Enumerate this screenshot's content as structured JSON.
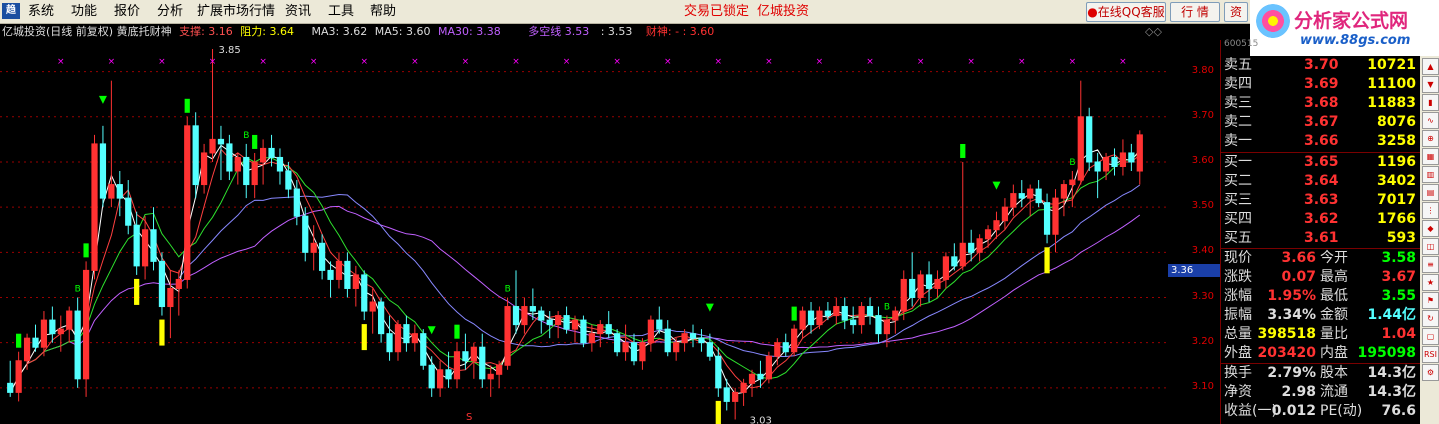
{
  "menubar": {
    "app_icon": "趋",
    "items": [
      "系统",
      "功能",
      "报价",
      "分析",
      "扩展市场行情",
      "资讯",
      "工具",
      "帮助"
    ],
    "status_locked": "交易已锁定",
    "status_brand": "亿城投资",
    "qq_button": "在线QQ客服",
    "quote_button": "行 情",
    "partial_button": "资"
  },
  "logo": {
    "text": "分析家公式网",
    "url": "www.88gs.com"
  },
  "legend": {
    "title": "亿城投资(日线 前复权) 黄底托财神",
    "support_label": "支撑:",
    "support_value": "3.16",
    "resistance_label": "阻力:",
    "resistance_value": "3.64",
    "ma3_label": "MA3:",
    "ma3_value": "3.62",
    "ma5_label": "MA5:",
    "ma5_value": "3.60",
    "ma30_label": "MA30:",
    "ma30_value": "3.38",
    "dk_label": "多空线",
    "dk_value": "3.53",
    "dk_value2": ": 3.53",
    "caishen_label": "财神:",
    "caishen_value": "- : 3.60",
    "partial_code": "600515"
  },
  "colors": {
    "up": "#ff3232",
    "down": "#54ffff",
    "yellow": "#ffff00",
    "green": "#00ff00",
    "ma_white": "#ffffff",
    "ma_red": "#ff4040",
    "ma_green": "#2ee02e",
    "ma_purple": "#c060ff",
    "ma_blue": "#8888ff",
    "grid": "#9a0000"
  },
  "annotations": {
    "high_label": "3.85",
    "low_label": "3.03",
    "marker_b": "B",
    "marker_s": "S"
  },
  "axis": {
    "ticks": [
      "3.80",
      "3.70",
      "3.60",
      "3.50",
      "3.40",
      "3.30",
      "3.20",
      "3.10"
    ],
    "current": "3.36"
  },
  "quote": {
    "asks": [
      {
        "label": "卖五",
        "price": "3.70",
        "vol": "10721"
      },
      {
        "label": "卖四",
        "price": "3.69",
        "vol": "11100"
      },
      {
        "label": "卖三",
        "price": "3.68",
        "vol": "11883"
      },
      {
        "label": "卖二",
        "price": "3.67",
        "vol": "8076"
      },
      {
        "label": "卖一",
        "price": "3.66",
        "vol": "3258"
      }
    ],
    "bids": [
      {
        "label": "买一",
        "price": "3.65",
        "vol": "1196"
      },
      {
        "label": "买二",
        "price": "3.64",
        "vol": "3402"
      },
      {
        "label": "买三",
        "price": "3.63",
        "vol": "7017"
      },
      {
        "label": "买四",
        "price": "3.62",
        "vol": "1766"
      },
      {
        "label": "买五",
        "price": "3.61",
        "vol": "593"
      }
    ],
    "stats": [
      {
        "l1": "现价",
        "v1": "3.66",
        "c1": "#ff3232",
        "l2": "今开",
        "v2": "3.58",
        "c2": "#00ff00"
      },
      {
        "l1": "涨跌",
        "v1": "0.07",
        "c1": "#ff3232",
        "l2": "最高",
        "v2": "3.67",
        "c2": "#ff3232"
      },
      {
        "l1": "涨幅",
        "v1": "1.95%",
        "c1": "#ff3232",
        "l2": "最低",
        "v2": "3.55",
        "c2": "#00ff00"
      },
      {
        "l1": "振幅",
        "v1": "3.34%",
        "c1": "#dddddd",
        "l2": "金额",
        "v2": "1.44亿",
        "c2": "#54ffff"
      },
      {
        "l1": "总量",
        "v1": "398518",
        "c1": "#ffff00",
        "l2": "量比",
        "v2": "1.04",
        "c2": "#ff3232"
      },
      {
        "l1": "外盘",
        "v1": "203420",
        "c1": "#ff3232",
        "l2": "内盘",
        "v2": "195098",
        "c2": "#00ff00"
      },
      {
        "l1": "换手",
        "v1": "2.79%",
        "c1": "#dddddd",
        "l2": "股本",
        "v2": "14.3亿",
        "c2": "#dddddd"
      },
      {
        "l1": "净资",
        "v1": "2.98",
        "c1": "#dddddd",
        "l2": "流通",
        "v2": "14.3亿",
        "c2": "#dddddd"
      },
      {
        "l1": "收益(一)",
        "v1": "0.012",
        "c1": "#dddddd",
        "l2": "PE(动)",
        "v2": "76.6",
        "c2": "#dddddd"
      }
    ]
  },
  "toolbar": {
    "rsi_label": "RSI"
  },
  "chart_data": {
    "type": "candlestick",
    "ylim": [
      3.02,
      3.87
    ],
    "grid_levels": [
      3.8,
      3.7,
      3.6,
      3.5,
      3.4,
      3.3,
      3.2,
      3.1
    ],
    "candles": [
      [
        3.11,
        3.16,
        3.08,
        3.09
      ],
      [
        3.09,
        3.18,
        3.07,
        3.16
      ],
      [
        3.16,
        3.22,
        3.14,
        3.21
      ],
      [
        3.21,
        3.24,
        3.18,
        3.19
      ],
      [
        3.19,
        3.27,
        3.17,
        3.25
      ],
      [
        3.25,
        3.28,
        3.2,
        3.22
      ],
      [
        3.22,
        3.26,
        3.18,
        3.23
      ],
      [
        3.23,
        3.28,
        3.2,
        3.27
      ],
      [
        3.27,
        3.3,
        3.1,
        3.12
      ],
      [
        3.12,
        3.38,
        3.08,
        3.36
      ],
      [
        3.36,
        3.66,
        3.34,
        3.64
      ],
      [
        3.64,
        3.68,
        3.5,
        3.52
      ],
      [
        3.52,
        3.78,
        3.5,
        3.55
      ],
      [
        3.55,
        3.58,
        3.48,
        3.52
      ],
      [
        3.52,
        3.56,
        3.44,
        3.46
      ],
      [
        3.46,
        3.49,
        3.35,
        3.37
      ],
      [
        3.37,
        3.48,
        3.34,
        3.45
      ],
      [
        3.45,
        3.5,
        3.36,
        3.38
      ],
      [
        3.38,
        3.4,
        3.26,
        3.28
      ],
      [
        3.28,
        3.36,
        3.21,
        3.32
      ],
      [
        3.32,
        3.36,
        3.26,
        3.34
      ],
      [
        3.34,
        3.7,
        3.32,
        3.68
      ],
      [
        3.68,
        3.71,
        3.52,
        3.55
      ],
      [
        3.55,
        3.64,
        3.53,
        3.62
      ],
      [
        3.62,
        3.85,
        3.6,
        3.65
      ],
      [
        3.65,
        3.68,
        3.56,
        3.64
      ],
      [
        3.64,
        3.66,
        3.56,
        3.58
      ],
      [
        3.58,
        3.62,
        3.55,
        3.61
      ],
      [
        3.61,
        3.64,
        3.52,
        3.55
      ],
      [
        3.55,
        3.62,
        3.52,
        3.6
      ],
      [
        3.6,
        3.65,
        3.55,
        3.63
      ],
      [
        3.63,
        3.66,
        3.59,
        3.61
      ],
      [
        3.61,
        3.63,
        3.55,
        3.58
      ],
      [
        3.58,
        3.6,
        3.52,
        3.54
      ],
      [
        3.54,
        3.56,
        3.46,
        3.48
      ],
      [
        3.48,
        3.5,
        3.38,
        3.4
      ],
      [
        3.4,
        3.46,
        3.36,
        3.42
      ],
      [
        3.42,
        3.44,
        3.34,
        3.36
      ],
      [
        3.36,
        3.38,
        3.3,
        3.34
      ],
      [
        3.34,
        3.4,
        3.32,
        3.38
      ],
      [
        3.38,
        3.4,
        3.3,
        3.32
      ],
      [
        3.32,
        3.37,
        3.28,
        3.35
      ],
      [
        3.35,
        3.36,
        3.25,
        3.27
      ],
      [
        3.27,
        3.32,
        3.22,
        3.29
      ],
      [
        3.29,
        3.3,
        3.2,
        3.22
      ],
      [
        3.22,
        3.26,
        3.16,
        3.18
      ],
      [
        3.18,
        3.25,
        3.16,
        3.24
      ],
      [
        3.24,
        3.26,
        3.18,
        3.2
      ],
      [
        3.2,
        3.24,
        3.18,
        3.22
      ],
      [
        3.22,
        3.23,
        3.14,
        3.15
      ],
      [
        3.15,
        3.17,
        3.08,
        3.1
      ],
      [
        3.1,
        3.16,
        3.08,
        3.14
      ],
      [
        3.14,
        3.18,
        3.1,
        3.12
      ],
      [
        3.12,
        3.2,
        3.1,
        3.18
      ],
      [
        3.18,
        3.22,
        3.14,
        3.16
      ],
      [
        3.16,
        3.2,
        3.12,
        3.19
      ],
      [
        3.19,
        3.22,
        3.1,
        3.12
      ],
      [
        3.12,
        3.15,
        3.08,
        3.13
      ],
      [
        3.13,
        3.16,
        3.1,
        3.15
      ],
      [
        3.15,
        3.3,
        3.14,
        3.28
      ],
      [
        3.28,
        3.36,
        3.22,
        3.24
      ],
      [
        3.24,
        3.3,
        3.22,
        3.28
      ],
      [
        3.28,
        3.32,
        3.25,
        3.27
      ],
      [
        3.27,
        3.28,
        3.22,
        3.25
      ],
      [
        3.25,
        3.27,
        3.21,
        3.24
      ],
      [
        3.24,
        3.27,
        3.21,
        3.26
      ],
      [
        3.26,
        3.28,
        3.22,
        3.23
      ],
      [
        3.23,
        3.26,
        3.2,
        3.25
      ],
      [
        3.25,
        3.26,
        3.19,
        3.2
      ],
      [
        3.2,
        3.24,
        3.18,
        3.22
      ],
      [
        3.22,
        3.25,
        3.19,
        3.24
      ],
      [
        3.24,
        3.27,
        3.21,
        3.22
      ],
      [
        3.22,
        3.23,
        3.17,
        3.18
      ],
      [
        3.18,
        3.24,
        3.16,
        3.2
      ],
      [
        3.2,
        3.22,
        3.15,
        3.16
      ],
      [
        3.16,
        3.21,
        3.14,
        3.2
      ],
      [
        3.2,
        3.26,
        3.18,
        3.25
      ],
      [
        3.25,
        3.28,
        3.22,
        3.23
      ],
      [
        3.23,
        3.25,
        3.17,
        3.18
      ],
      [
        3.18,
        3.21,
        3.16,
        3.2
      ],
      [
        3.2,
        3.23,
        3.18,
        3.22
      ],
      [
        3.22,
        3.24,
        3.19,
        3.21
      ],
      [
        3.21,
        3.23,
        3.18,
        3.2
      ],
      [
        3.2,
        3.22,
        3.16,
        3.17
      ],
      [
        3.17,
        3.19,
        3.08,
        3.1
      ],
      [
        3.1,
        3.12,
        3.05,
        3.07
      ],
      [
        3.07,
        3.1,
        3.03,
        3.09
      ],
      [
        3.09,
        3.12,
        3.06,
        3.11
      ],
      [
        3.11,
        3.14,
        3.08,
        3.13
      ],
      [
        3.13,
        3.16,
        3.1,
        3.12
      ],
      [
        3.12,
        3.18,
        3.11,
        3.17
      ],
      [
        3.17,
        3.21,
        3.15,
        3.2
      ],
      [
        3.2,
        3.22,
        3.17,
        3.18
      ],
      [
        3.18,
        3.24,
        3.17,
        3.23
      ],
      [
        3.23,
        3.28,
        3.21,
        3.27
      ],
      [
        3.27,
        3.29,
        3.22,
        3.24
      ],
      [
        3.24,
        3.28,
        3.23,
        3.27
      ],
      [
        3.27,
        3.29,
        3.25,
        3.26
      ],
      [
        3.26,
        3.3,
        3.24,
        3.28
      ],
      [
        3.28,
        3.3,
        3.23,
        3.25
      ],
      [
        3.25,
        3.28,
        3.22,
        3.24
      ],
      [
        3.24,
        3.29,
        3.22,
        3.28
      ],
      [
        3.28,
        3.3,
        3.24,
        3.26
      ],
      [
        3.26,
        3.28,
        3.2,
        3.22
      ],
      [
        3.22,
        3.26,
        3.19,
        3.25
      ],
      [
        3.25,
        3.28,
        3.22,
        3.27
      ],
      [
        3.27,
        3.36,
        3.25,
        3.34
      ],
      [
        3.34,
        3.4,
        3.28,
        3.3
      ],
      [
        3.3,
        3.36,
        3.28,
        3.35
      ],
      [
        3.35,
        3.38,
        3.29,
        3.32
      ],
      [
        3.32,
        3.36,
        3.3,
        3.34
      ],
      [
        3.34,
        3.4,
        3.32,
        3.39
      ],
      [
        3.39,
        3.42,
        3.36,
        3.37
      ],
      [
        3.37,
        3.6,
        3.36,
        3.42
      ],
      [
        3.42,
        3.45,
        3.38,
        3.4
      ],
      [
        3.4,
        3.44,
        3.38,
        3.43
      ],
      [
        3.43,
        3.46,
        3.41,
        3.45
      ],
      [
        3.45,
        3.49,
        3.43,
        3.47
      ],
      [
        3.47,
        3.52,
        3.45,
        3.5
      ],
      [
        3.5,
        3.55,
        3.48,
        3.53
      ],
      [
        3.53,
        3.56,
        3.5,
        3.52
      ],
      [
        3.52,
        3.55,
        3.48,
        3.54
      ],
      [
        3.54,
        3.56,
        3.5,
        3.51
      ],
      [
        3.51,
        3.53,
        3.42,
        3.44
      ],
      [
        3.44,
        3.54,
        3.4,
        3.52
      ],
      [
        3.52,
        3.56,
        3.48,
        3.55
      ],
      [
        3.55,
        3.58,
        3.5,
        3.56
      ],
      [
        3.56,
        3.78,
        3.55,
        3.7
      ],
      [
        3.7,
        3.72,
        3.58,
        3.6
      ],
      [
        3.6,
        3.62,
        3.52,
        3.58
      ],
      [
        3.58,
        3.62,
        3.56,
        3.61
      ],
      [
        3.61,
        3.63,
        3.57,
        3.59
      ],
      [
        3.59,
        3.65,
        3.57,
        3.62
      ],
      [
        3.62,
        3.64,
        3.58,
        3.6
      ],
      [
        3.58,
        3.67,
        3.55,
        3.66
      ]
    ]
  }
}
